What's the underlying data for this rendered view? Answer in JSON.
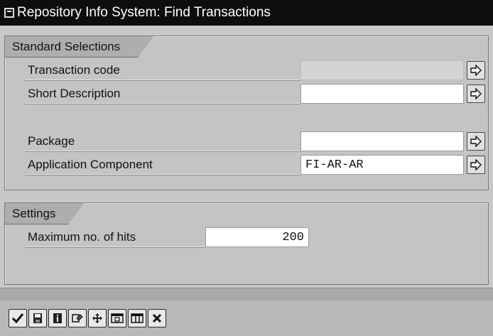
{
  "window": {
    "title": "Repository Info System: Find Transactions"
  },
  "standard_selections": {
    "tab_label": "Standard Selections",
    "fields": [
      {
        "label": "Transaction code",
        "value": "",
        "enabled": false
      },
      {
        "label": "Short Description",
        "value": "",
        "enabled": true
      },
      {
        "label": "Package",
        "value": "",
        "enabled": true
      },
      {
        "label": "Application Component",
        "value": "FI-AR-AR",
        "enabled": true
      }
    ]
  },
  "settings": {
    "tab_label": "Settings",
    "max_hits_label": "Maximum no. of hits",
    "max_hits_value": "200"
  },
  "toolbar": {
    "buttons": [
      "execute-icon",
      "save-icon",
      "info-icon",
      "variants-icon",
      "move-icon",
      "expand-icon",
      "columns-icon",
      "cancel-icon"
    ]
  },
  "colors": {
    "title_bar": "#0e0e0e",
    "frame": "#c4c4c4",
    "tab": "#aeaeae",
    "field": "#ffffff"
  }
}
